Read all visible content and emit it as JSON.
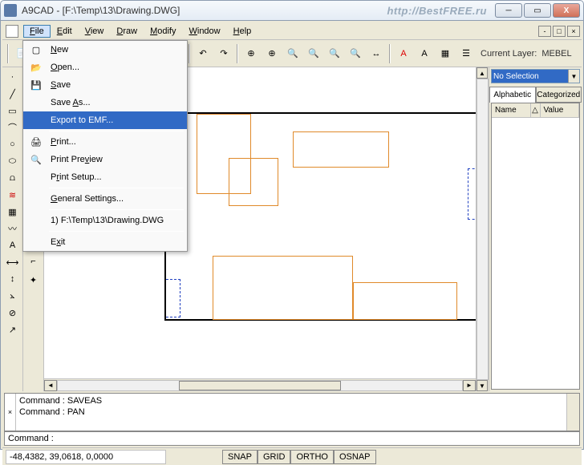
{
  "titlebar": {
    "title": "A9CAD - [F:\\Temp\\13\\Drawing.DWG]",
    "watermark": "http://BestFREE.ru"
  },
  "menubar": {
    "items": [
      "File",
      "Edit",
      "View",
      "Draw",
      "Modify",
      "Window",
      "Help"
    ]
  },
  "toolbar": {
    "layer_label": "Current Layer:",
    "layer_value": "MEBEL"
  },
  "file_menu": {
    "items": [
      {
        "label": "New",
        "icon": "new"
      },
      {
        "label": "Open...",
        "icon": "open"
      },
      {
        "label": "Save",
        "icon": "save"
      },
      {
        "label": "Save As..."
      },
      {
        "label": "Export to EMF...",
        "highlighted": true
      },
      {
        "label": "Print...",
        "icon": "print"
      },
      {
        "label": "Print Preview",
        "icon": "preview"
      },
      {
        "label": "Print Setup..."
      },
      {
        "label": "General Settings..."
      },
      {
        "label": "1) F:\\Temp\\13\\Drawing.DWG"
      },
      {
        "label": "Exit"
      }
    ]
  },
  "props": {
    "selection": "No Selection",
    "tabs": [
      "Alphabetic",
      "Categorized"
    ],
    "cols": [
      "Name",
      "Value"
    ]
  },
  "cmd": {
    "line1": "Command : SAVEAS",
    "line2": "Command : PAN",
    "prompt": "Command : "
  },
  "status": {
    "coords": "-48,4382, 39,0618, 0,0000",
    "snap": "SNAP",
    "grid": "GRID",
    "ortho": "ORTHO",
    "osnap": "OSNAP"
  }
}
